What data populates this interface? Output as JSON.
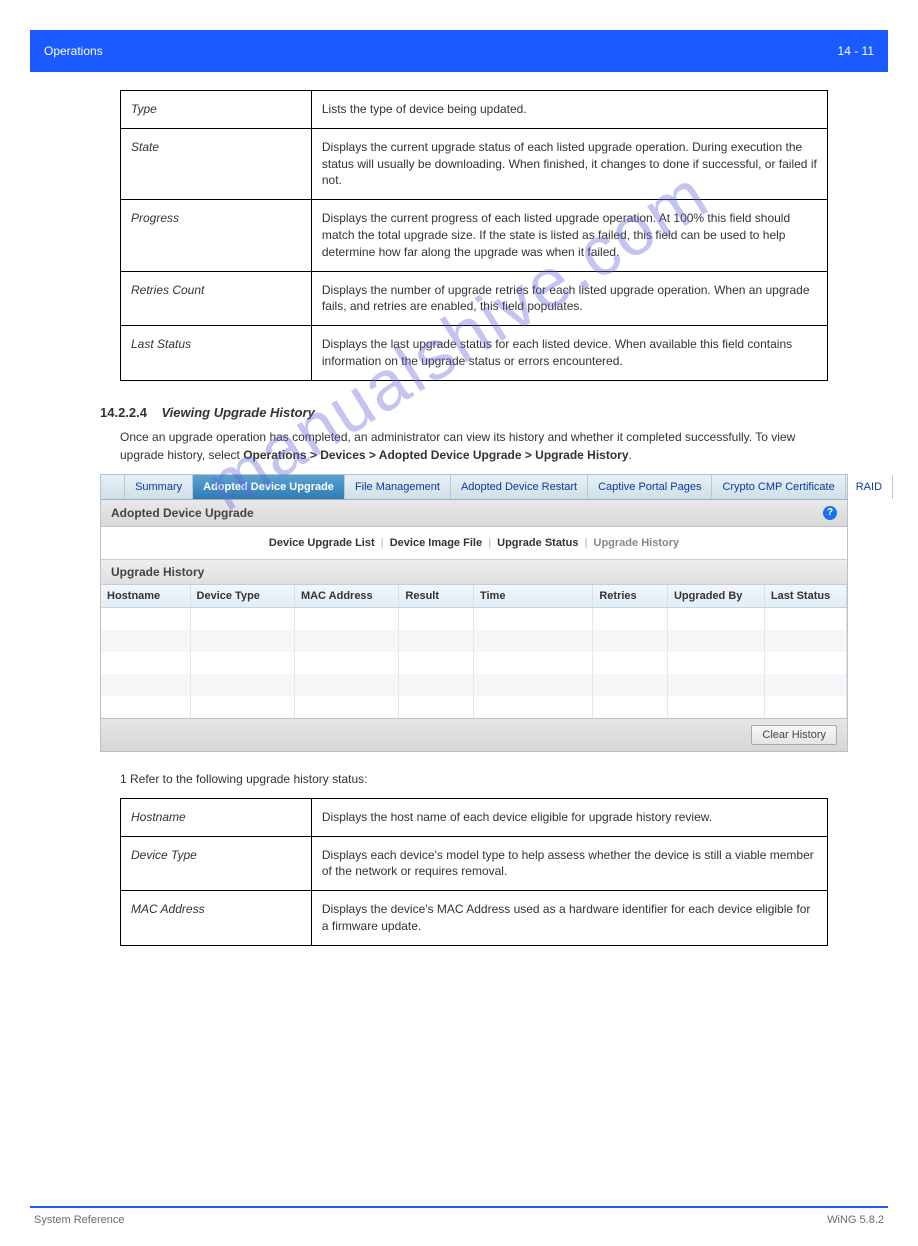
{
  "banner": {
    "left": "Operations",
    "right": "14 - 11"
  },
  "watermark": "manualshive.com",
  "definitions1": [
    {
      "label": "Type",
      "desc": "Lists the type of device being updated."
    },
    {
      "label": "State",
      "desc": "Displays the current upgrade status of each listed upgrade operation. During execution the status will usually be downloading. When finished, it changes to done if successful, or failed if not."
    },
    {
      "label": "Progress",
      "desc": "Displays the current progress of each listed upgrade operation. At 100% this field should match the total upgrade size. If the state is listed as failed, this field can be used to help determine how far along the upgrade was when it failed."
    },
    {
      "label": "Retries Count",
      "desc": "Displays the number of upgrade retries for each listed upgrade operation. When an upgrade fails, and retries are enabled, this field populates."
    },
    {
      "label": "Last Status",
      "desc": "Displays the last upgrade status for each listed device. When available this field contains information on the upgrade status or errors encountered."
    }
  ],
  "section": {
    "num": "14.2.2.4",
    "title": "Viewing Upgrade History"
  },
  "intro": {
    "prefix": "Once an upgrade operation has completed, an administrator can view its history and whether it completed successfully. To view upgrade history, select ",
    "path": "Operations > Devices > Adopted Device Upgrade > Upgrade History",
    "suffix": "."
  },
  "screenshot": {
    "tabs": [
      "Summary",
      "Adopted Device Upgrade",
      "File Management",
      "Adopted Device Restart",
      "Captive Portal Pages",
      "Crypto CMP Certificate",
      "RAID"
    ],
    "activeTabIndex": 1,
    "panelTitle": "Adopted Device Upgrade",
    "subtabs": [
      "Device Upgrade List",
      "Device Image File",
      "Upgrade Status",
      "Upgrade History"
    ],
    "currentSubtabIndex": 3,
    "sectionTitle": "Upgrade History",
    "columns": [
      "Hostname",
      "Device Type",
      "MAC Address",
      "Result",
      "Time",
      "Retries",
      "Upgraded By",
      "Last Status"
    ],
    "clearBtn": "Clear History"
  },
  "step": "1    Refer to the following upgrade history status:",
  "definitions2": [
    {
      "label": "Hostname",
      "desc": "Displays the host name of each device eligible for upgrade history review."
    },
    {
      "label": "Device Type",
      "desc": "Displays each device's model type to help assess whether the device is still a viable member of the network or requires removal."
    },
    {
      "label": "MAC Address",
      "desc": "Displays the device's MAC Address used as a hardware identifier for each device eligible for a firmware update."
    }
  ],
  "footer": {
    "left": "System Reference",
    "right": "WiNG 5.8.2"
  }
}
